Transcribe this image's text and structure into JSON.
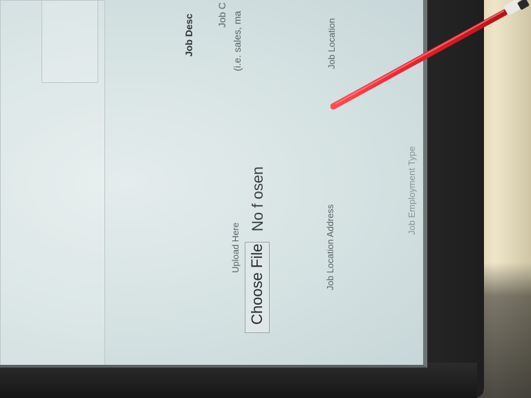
{
  "form": {
    "job_description_label": "Job Desc",
    "job_category_label": "Job C",
    "job_category_hint": "(i.e. sales, ma",
    "upload_label": "Upload Here",
    "choose_file_button": "Choose File",
    "no_file_text": "No f   osen",
    "job_location_address_label": "Job Location Address",
    "job_location_label": "Job Location",
    "job_employment_type_label": "Job Employment Type"
  },
  "colors": {
    "screen": "#d9e4e4",
    "bezel": "#2b2b2b",
    "stylus": "#e3202a"
  }
}
